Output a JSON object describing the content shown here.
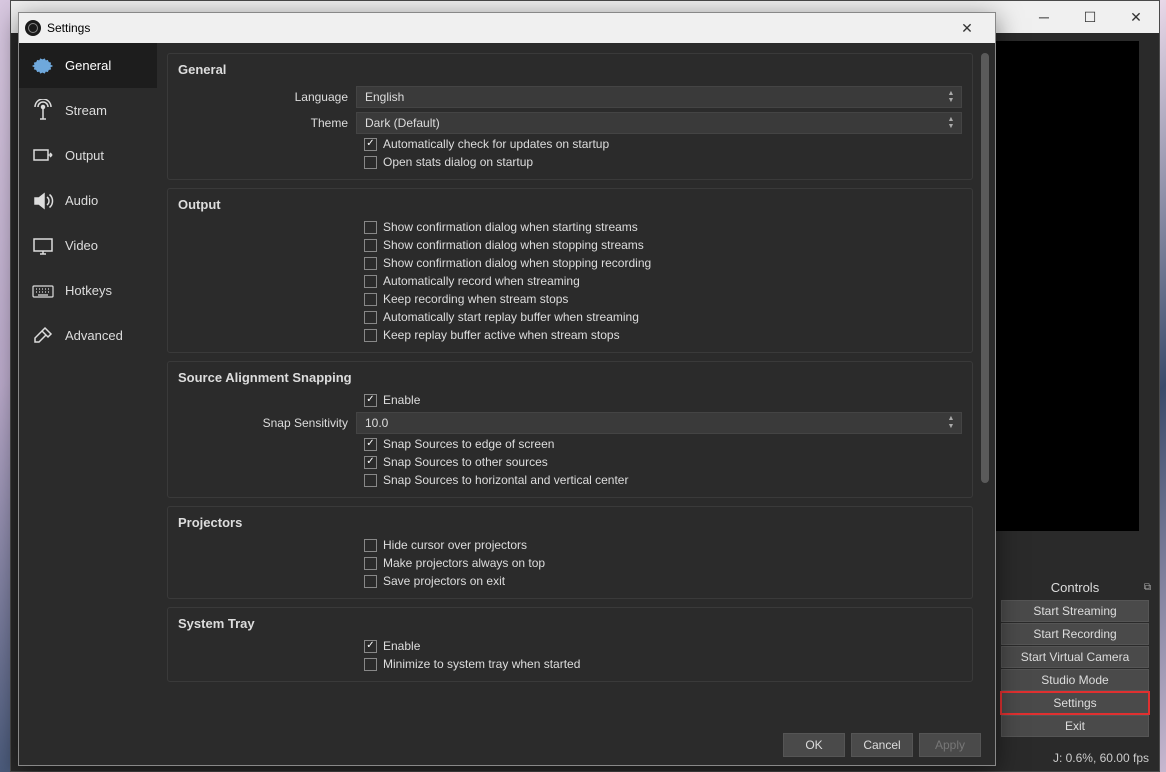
{
  "bg": {
    "controls_header": "Controls",
    "buttons": [
      "Start Streaming",
      "Start Recording",
      "Start Virtual Camera",
      "Studio Mode",
      "Settings",
      "Exit"
    ],
    "status": "J: 0.6%, 60.00 fps"
  },
  "dialog": {
    "title": "Settings",
    "sidebar": [
      {
        "label": "General",
        "icon": "gear"
      },
      {
        "label": "Stream",
        "icon": "antenna"
      },
      {
        "label": "Output",
        "icon": "output"
      },
      {
        "label": "Audio",
        "icon": "audio"
      },
      {
        "label": "Video",
        "icon": "video"
      },
      {
        "label": "Hotkeys",
        "icon": "keyboard"
      },
      {
        "label": "Advanced",
        "icon": "tools"
      }
    ],
    "footer": {
      "ok": "OK",
      "cancel": "Cancel",
      "apply": "Apply"
    },
    "groups": {
      "general": {
        "title": "General",
        "language_label": "Language",
        "language_value": "English",
        "theme_label": "Theme",
        "theme_value": "Dark (Default)",
        "cb1": "Automatically check for updates on startup",
        "cb2": "Open stats dialog on startup"
      },
      "output": {
        "title": "Output",
        "cb1": "Show confirmation dialog when starting streams",
        "cb2": "Show confirmation dialog when stopping streams",
        "cb3": "Show confirmation dialog when stopping recording",
        "cb4": "Automatically record when streaming",
        "cb5": "Keep recording when stream stops",
        "cb6": "Automatically start replay buffer when streaming",
        "cb7": "Keep replay buffer active when stream stops"
      },
      "snap": {
        "title": "Source Alignment Snapping",
        "cb_enable": "Enable",
        "sens_label": "Snap Sensitivity",
        "sens_value": "10.0",
        "cb1": "Snap Sources to edge of screen",
        "cb2": "Snap Sources to other sources",
        "cb3": "Snap Sources to horizontal and vertical center"
      },
      "projectors": {
        "title": "Projectors",
        "cb1": "Hide cursor over projectors",
        "cb2": "Make projectors always on top",
        "cb3": "Save projectors on exit"
      },
      "tray": {
        "title": "System Tray",
        "cb_enable": "Enable",
        "cb1": "Minimize to system tray when started"
      }
    }
  }
}
